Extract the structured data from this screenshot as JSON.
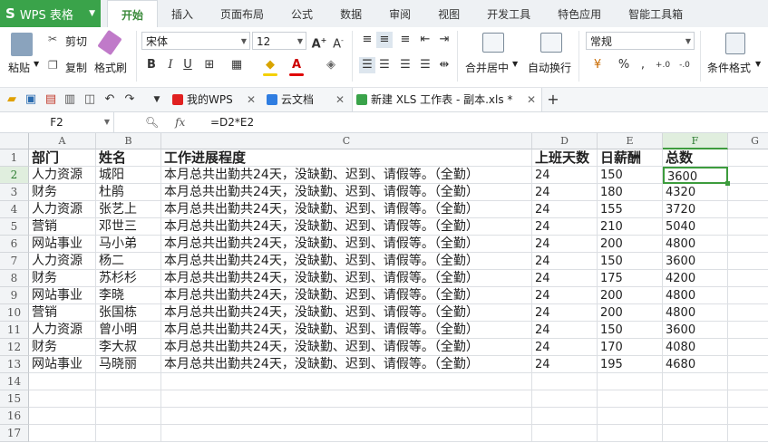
{
  "app": {
    "logo": "S",
    "name": "WPS 表格"
  },
  "menu_tabs": [
    "开始",
    "插入",
    "页面布局",
    "公式",
    "数据",
    "审阅",
    "视图",
    "开发工具",
    "特色应用",
    "智能工具箱"
  ],
  "active_menu": "开始",
  "ribbon": {
    "paste": "粘贴",
    "cut": "剪切",
    "copy": "复制",
    "format_painter": "格式刷",
    "font_name": "宋体",
    "font_size": "12",
    "bold": "B",
    "italic": "I",
    "underline": "U",
    "merge_center": "合并居中",
    "wrap_text": "自动换行",
    "number_format": "常规",
    "percent": "%",
    "comma": ",",
    "inc_decimal": "+.0",
    "dec_decimal": "-.0",
    "conditional_format": "条件格式"
  },
  "doc_tabs": [
    {
      "label": "我的WPS"
    },
    {
      "label": "云文档"
    },
    {
      "label": "新建 XLS 工作表 - 副本.xls *"
    }
  ],
  "formula_bar": {
    "cell_ref": "F2",
    "fx": "fx",
    "formula": "=D2*E2"
  },
  "columns": [
    "A",
    "B",
    "C",
    "D",
    "E",
    "F",
    "G"
  ],
  "rows": [
    "1",
    "2",
    "3",
    "4",
    "5",
    "6",
    "7",
    "8",
    "9",
    "10",
    "11",
    "12",
    "13",
    "14",
    "15",
    "16",
    "17"
  ],
  "table": {
    "headers": [
      "部门",
      "姓名",
      "工作进展程度",
      "上班天数",
      "日薪酬",
      "总数"
    ],
    "data": [
      [
        "人力资源",
        "城阳",
        "本月总共出勤共24天，没缺勤、迟到、请假等。（全勤）",
        "24",
        "150",
        "3600"
      ],
      [
        "财务",
        "杜鹃",
        "本月总共出勤共24天，没缺勤、迟到、请假等。（全勤）",
        "24",
        "180",
        "4320"
      ],
      [
        "人力资源",
        "张艺上",
        "本月总共出勤共24天，没缺勤、迟到、请假等。（全勤）",
        "24",
        "155",
        "3720"
      ],
      [
        "营销",
        "邓世三",
        "本月总共出勤共24天，没缺勤、迟到、请假等。（全勤）",
        "24",
        "210",
        "5040"
      ],
      [
        "网站事业",
        "马小弟",
        "本月总共出勤共24天，没缺勤、迟到、请假等。（全勤）",
        "24",
        "200",
        "4800"
      ],
      [
        "人力资源",
        "杨二",
        "本月总共出勤共24天，没缺勤、迟到、请假等。（全勤）",
        "24",
        "150",
        "3600"
      ],
      [
        "财务",
        "苏杉杉",
        "本月总共出勤共24天，没缺勤、迟到、请假等。（全勤）",
        "24",
        "175",
        "4200"
      ],
      [
        "网站事业",
        "李晓",
        "本月总共出勤共24天，没缺勤、迟到、请假等。（全勤）",
        "24",
        "200",
        "4800"
      ],
      [
        "营销",
        "张国栋",
        "本月总共出勤共24天，没缺勤、迟到、请假等。（全勤）",
        "24",
        "200",
        "4800"
      ],
      [
        "人力资源",
        "曾小明",
        "本月总共出勤共24天，没缺勤、迟到、请假等。（全勤）",
        "24",
        "150",
        "3600"
      ],
      [
        "财务",
        "李大叔",
        "本月总共出勤共24天，没缺勤、迟到、请假等。（全勤）",
        "24",
        "170",
        "4080"
      ],
      [
        "网站事业",
        "马晓丽",
        "本月总共出勤共24天，没缺勤、迟到、请假等。（全勤）",
        "24",
        "195",
        "4680"
      ]
    ]
  },
  "selected_cell": "F2",
  "colors": {
    "accent": "#3d9c3d",
    "app_green": "#3aa34a"
  }
}
